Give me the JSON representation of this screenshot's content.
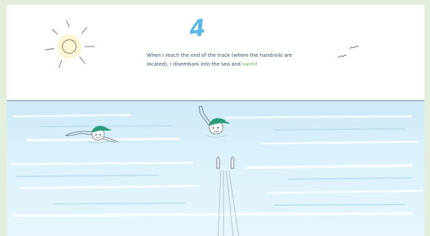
{
  "illustration": {
    "step_number": "4",
    "caption_before": "When I reach the end of the track (where the handrails are located), I disembark into the sea and ",
    "caption_highlight": "swim",
    "caption_after": "!",
    "colors": {
      "sky": "#ffffff",
      "sea": "#d6eef9",
      "step_number": "#5fb8e4",
      "caption_text": "#2d4d6b",
      "highlight": "#64c55a",
      "cap": "#2e9d7c",
      "frame": "#e3efdc"
    }
  }
}
